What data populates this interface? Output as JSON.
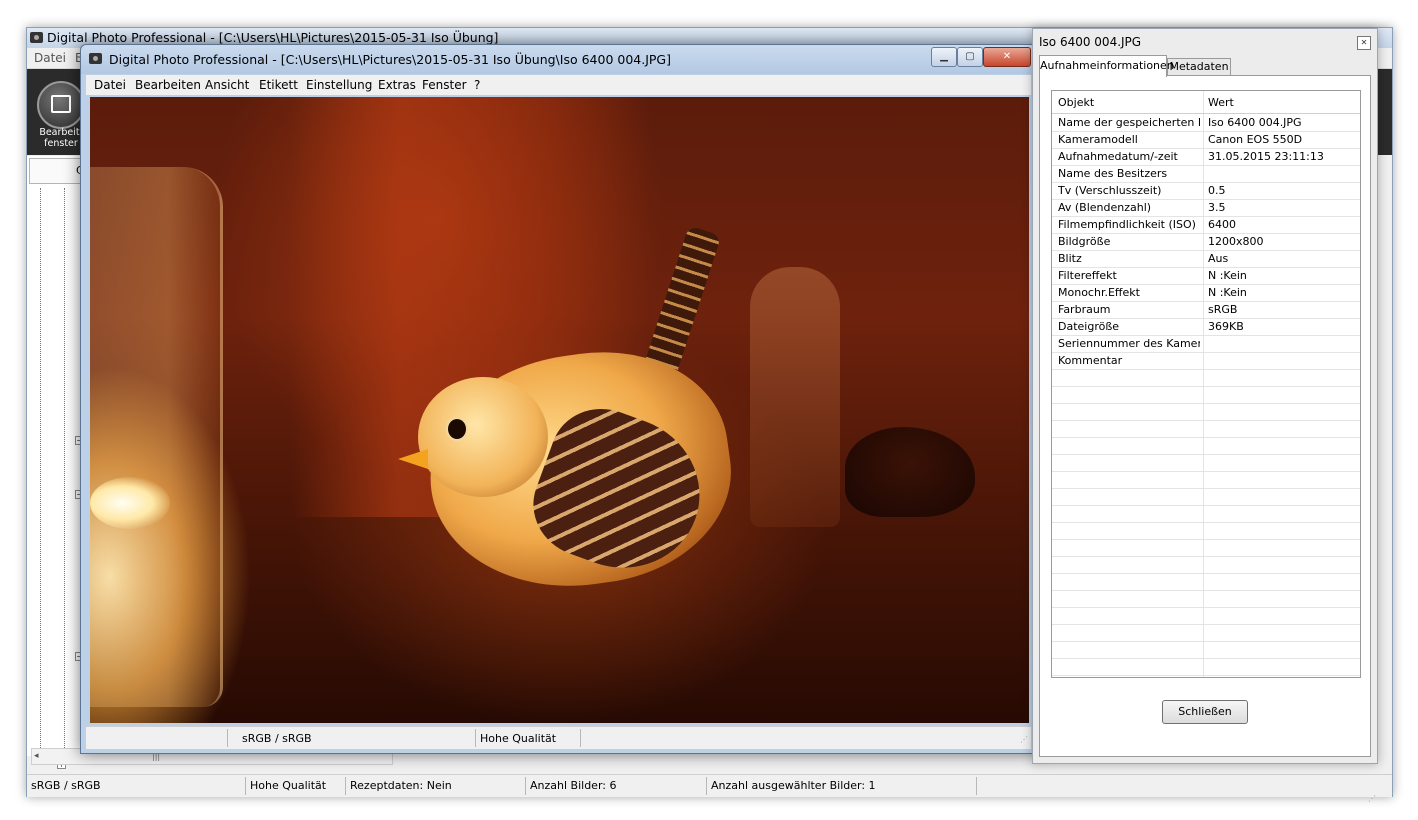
{
  "main_window": {
    "title": "Digital Photo Professional - [C:\\Users\\HL\\Pictures\\2015-05-31 Iso Übung]",
    "menu": [
      "Datei",
      "B"
    ],
    "edit_button_label": "Bearbeit.\nfenster",
    "side_tab_label": "C",
    "status": {
      "color_space": "sRGB / sRGB",
      "quality": "Hohe Qualität",
      "recipe": "Rezeptdaten: Nein",
      "image_count": "Anzahl Bilder: 6",
      "selected_count": "Anzahl ausgewählter Bilder: 1"
    }
  },
  "viewer_window": {
    "title": "Digital Photo Professional - [C:\\Users\\HL\\Pictures\\2015-05-31 Iso Übung\\Iso 6400    004.JPG]",
    "menu": [
      "Datei",
      "Bearbeiten",
      "Ansicht",
      "Etikett",
      "Einstellung",
      "Extras",
      "Fenster",
      "?"
    ],
    "status": {
      "color_space": "sRGB / sRGB",
      "quality": "Hohe Qualität"
    }
  },
  "info_dialog": {
    "title": "Iso 6400    004.JPG",
    "tabs": [
      "Aufnahmeinformationen",
      "Metadaten"
    ],
    "columns": [
      "Objekt",
      "Wert"
    ],
    "rows": [
      {
        "key": "Name der gespeicherten D...",
        "value": "Iso 6400    004.JPG"
      },
      {
        "key": "Kameramodell",
        "value": "Canon EOS 550D"
      },
      {
        "key": "Aufnahmedatum/-zeit",
        "value": "31.05.2015 23:11:13"
      },
      {
        "key": "Name des Besitzers",
        "value": ""
      },
      {
        "key": "Tv (Verschlusszeit)",
        "value": "0.5"
      },
      {
        "key": "Av (Blendenzahl)",
        "value": "3.5"
      },
      {
        "key": "Filmempfindlichkeit (ISO)",
        "value": "6400"
      },
      {
        "key": "Bildgröße",
        "value": "1200x800"
      },
      {
        "key": "Blitz",
        "value": "Aus"
      },
      {
        "key": "Filtereffekt",
        "value": "N :Kein"
      },
      {
        "key": "Monochr.Effekt",
        "value": "N :Kein"
      },
      {
        "key": "Farbraum",
        "value": "sRGB"
      },
      {
        "key": "Dateigröße",
        "value": "369KB"
      },
      {
        "key": "Seriennummer des Kamera...",
        "value": ""
      },
      {
        "key": "Kommentar",
        "value": ""
      }
    ],
    "close_button_label": "Schließen"
  },
  "icons": {
    "app": "camera-icon",
    "edit": "edit-window-icon",
    "close": "close-icon",
    "minimize": "minimize-icon",
    "maximize": "maximize-icon"
  }
}
